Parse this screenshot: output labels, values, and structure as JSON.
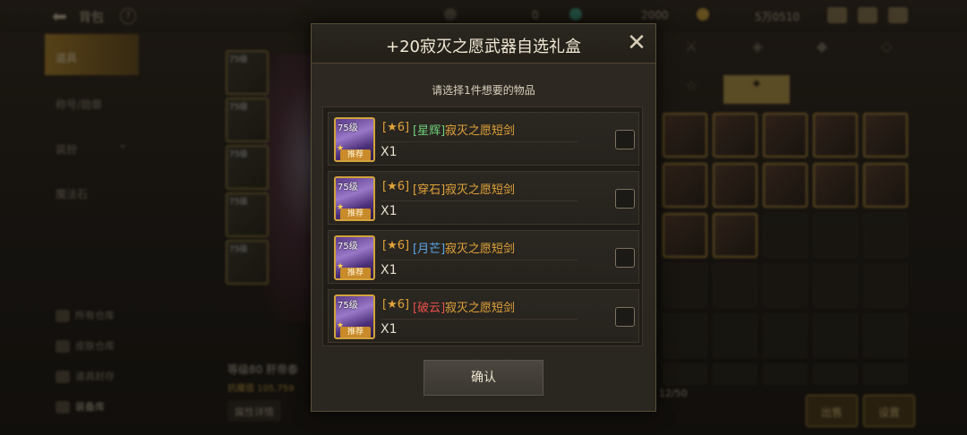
{
  "topbar": {
    "title": "背包",
    "help": "?",
    "currency1": "0",
    "currency2": "2000",
    "currency3": "5万0510"
  },
  "sidebar": {
    "items": [
      {
        "label": "道具"
      },
      {
        "label": "称号/勋章"
      },
      {
        "label": "装扮"
      },
      {
        "label": "魔法石"
      }
    ],
    "bottom": [
      {
        "label": "所有仓库"
      },
      {
        "label": "皮肤仓库"
      },
      {
        "label": "道具封存"
      },
      {
        "label": "装备库"
      }
    ]
  },
  "left_panel": {
    "card_levels": [
      "75级",
      "75级",
      "75级",
      "75级",
      "75级"
    ],
    "char_name": "等级80 肝帝泰",
    "char_stat": "抗魔值 105,759",
    "btn_attr": "属性详情"
  },
  "right_panel": {
    "count": "12/50",
    "btn_sell": "出售",
    "btn_settings": "设置"
  },
  "modal": {
    "title": "+20寂灭之愿武器自选礼盒",
    "close": "✕",
    "subtitle": "请选择1件想要的物品",
    "items": [
      {
        "level": "75级",
        "prefix": "[★6]",
        "name": "[星辉]",
        "name_color": "#6ecf7a",
        "suffix": "寂灭之愿短剑",
        "qty": "X1",
        "tag": "推荐"
      },
      {
        "level": "75级",
        "prefix": "[★6]",
        "name": "[穿石]",
        "name_color": "#e2a43a",
        "suffix": "寂灭之愿短剑",
        "qty": "X1",
        "tag": "推荐"
      },
      {
        "level": "75级",
        "prefix": "[★6]",
        "name": "[月芒]",
        "name_color": "#5aa7e6",
        "suffix": "寂灭之愿短剑",
        "qty": "X1",
        "tag": "推荐"
      },
      {
        "level": "75级",
        "prefix": "[★6]",
        "name": "[破云]",
        "name_color": "#e8504a",
        "suffix": "寂灭之愿短剑",
        "qty": "X1",
        "tag": "推荐"
      }
    ],
    "confirm": "确认"
  },
  "colors": {
    "accent_gold": "#c4a44c",
    "modal_bg": "#2e2922",
    "item_border": "#d2a33c"
  }
}
